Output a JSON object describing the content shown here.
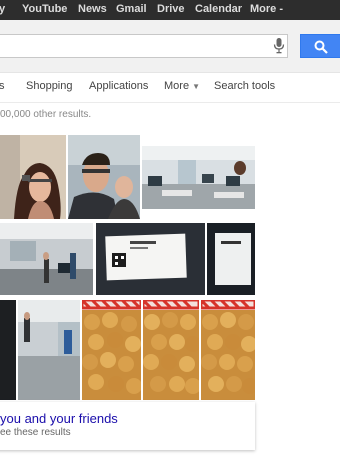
{
  "top_bar": {
    "links": [
      "y",
      "YouTube",
      "News",
      "Gmail",
      "Drive",
      "Calendar",
      "More -"
    ]
  },
  "search": {
    "query": "",
    "mic_icon": "microphone-icon",
    "button_icon": "magnifier-icon",
    "accent_color": "#4285f4"
  },
  "nav": {
    "tabs": [
      "s",
      "Shopping",
      "Applications",
      "More",
      "Search tools"
    ]
  },
  "results": {
    "stats_text": "00,000 other results."
  },
  "image_grid": {
    "images": [
      "selfie-with-glasses",
      "two-men-selfie",
      "open-office",
      "office-hallway",
      "business-card",
      "card-on-table",
      "dark-edge",
      "office-corridor",
      "tater-tots-1",
      "tater-tots-2",
      "tater-tots-3"
    ]
  },
  "card": {
    "title": "you and your friends",
    "subtitle": "ee these results"
  }
}
